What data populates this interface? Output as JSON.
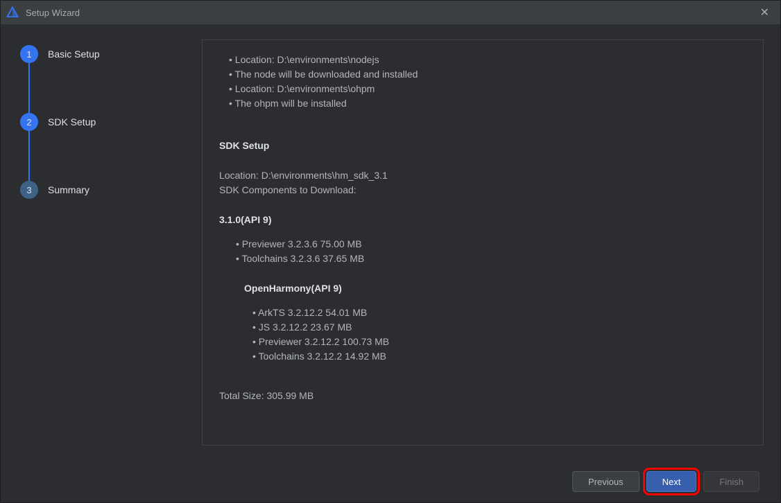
{
  "window": {
    "title": "Setup Wizard",
    "close": "✕"
  },
  "steps": {
    "s1": {
      "num": "1",
      "label": "Basic Setup"
    },
    "s2": {
      "num": "2",
      "label": "SDK Setup"
    },
    "s3": {
      "num": "3",
      "label": "Summary"
    }
  },
  "content": {
    "top_notes": [
      "Location: D:\\environments\\nodejs",
      "The node will be downloaded and installed",
      "Location: D:\\environments\\ohpm",
      "The ohpm will be installed"
    ],
    "sdk_heading": "SDK Setup",
    "sdk_location": "Location: D:\\environments\\hm_sdk_3.1",
    "sdk_components_label": "SDK Components to Download:",
    "api_heading": "3.1.0(API 9)",
    "api_items": [
      "Previewer  3.2.3.6  75.00 MB",
      "Toolchains  3.2.3.6  37.65 MB"
    ],
    "oh_heading": "OpenHarmony(API 9)",
    "oh_items": [
      "ArkTS  3.2.12.2  54.01 MB",
      "JS  3.2.12.2  23.67 MB",
      "Previewer  3.2.12.2  100.73 MB",
      "Toolchains  3.2.12.2  14.92 MB"
    ],
    "total": "Total Size: 305.99 MB"
  },
  "buttons": {
    "previous": "Previous",
    "next": "Next",
    "finish": "Finish"
  }
}
